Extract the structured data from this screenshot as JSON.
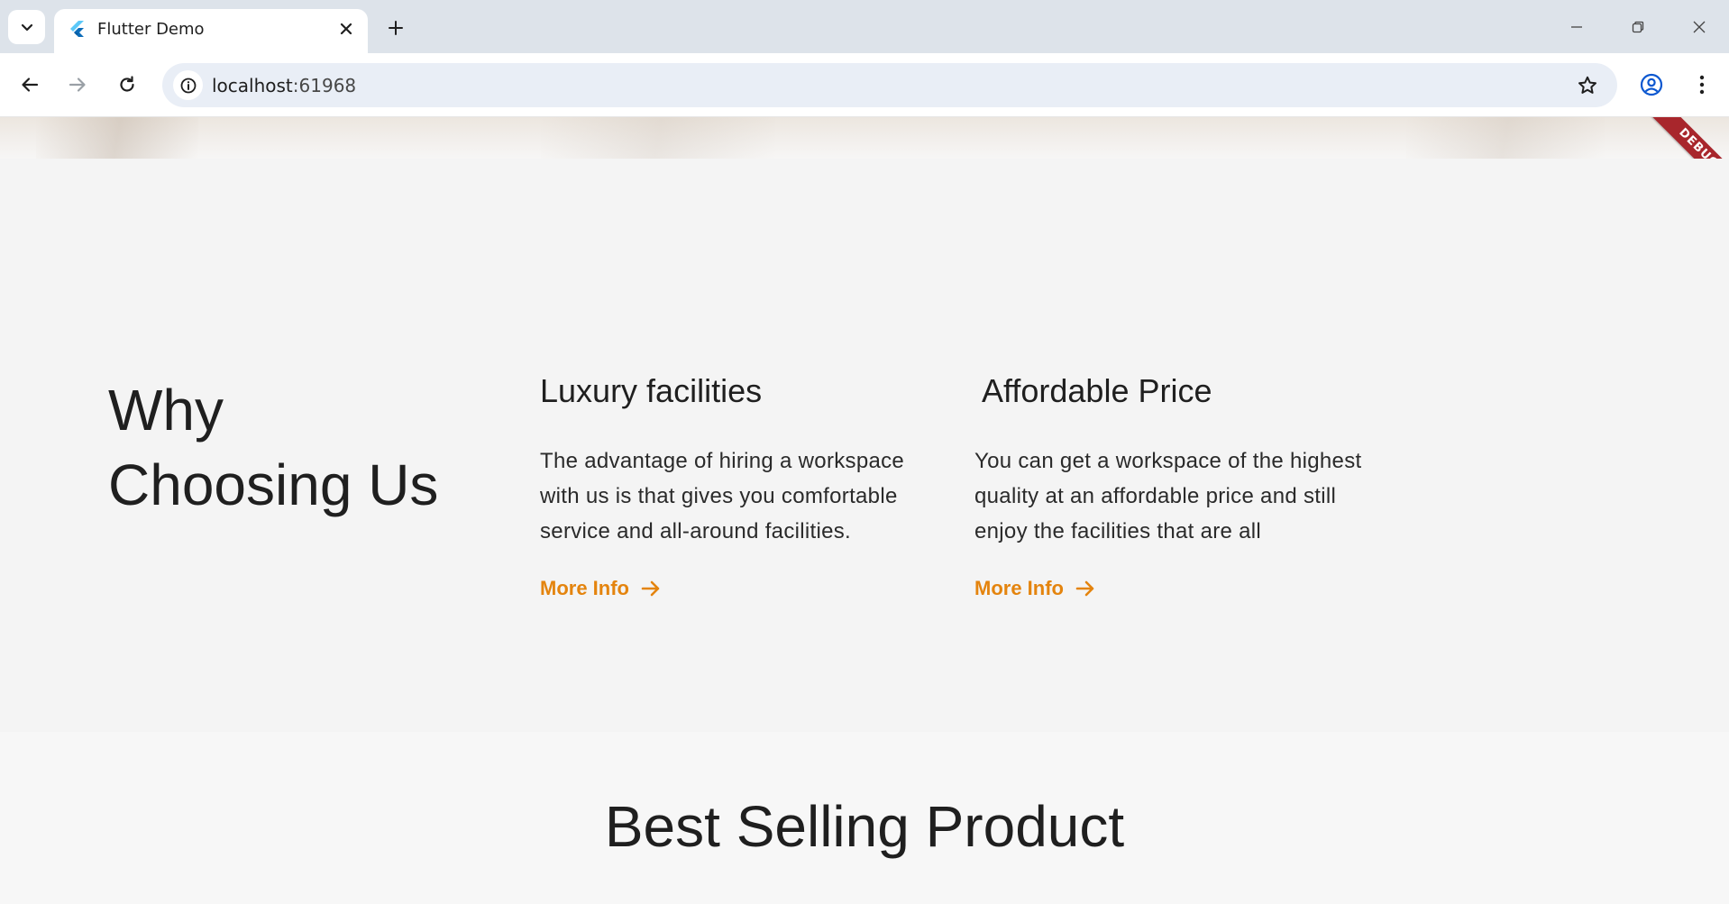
{
  "browser": {
    "tab_title": "Flutter Demo",
    "url_host": "localhost",
    "url_port": ":61968"
  },
  "page": {
    "debug_label": "DEBUG",
    "why_section": {
      "title_line1": "Why",
      "title_line2": "Choosing Us",
      "features": [
        {
          "title": "Luxury facilities",
          "description": "The advantage of hiring a workspace with us is that gives you comfortable service and all-around facilities.",
          "link_label": "More Info"
        },
        {
          "title": "Affordable Price",
          "description": "You can get a workspace of the highest quality at an affordable price and still enjoy the facilities that are all",
          "link_label": "More Info"
        }
      ]
    },
    "product_section": {
      "title": "Best Selling Product"
    }
  },
  "colors": {
    "accent": "#e4840e",
    "debug_banner": "#a8262c",
    "text": "#1f1f1f"
  }
}
